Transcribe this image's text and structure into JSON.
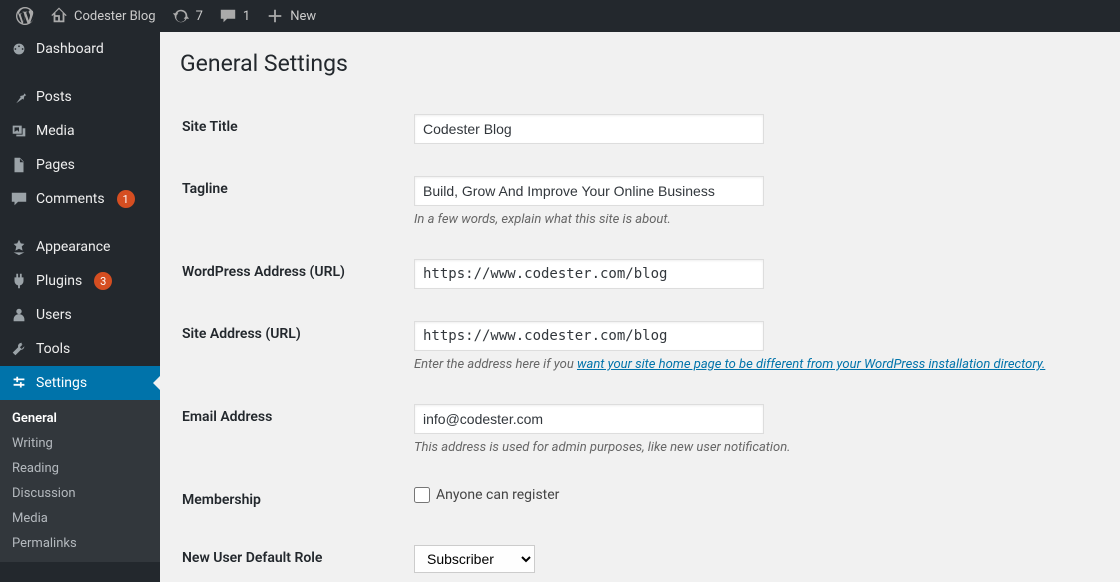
{
  "adminbar": {
    "site_name": "Codester Blog",
    "updates_count": "7",
    "comments_count": "1",
    "new_label": "New"
  },
  "sidebar": {
    "items": [
      {
        "label": "Dashboard",
        "icon": "dashboard"
      },
      {
        "label": "Posts",
        "icon": "pin"
      },
      {
        "label": "Media",
        "icon": "media"
      },
      {
        "label": "Pages",
        "icon": "pages"
      },
      {
        "label": "Comments",
        "icon": "comment",
        "badge": "1"
      },
      {
        "label": "Appearance",
        "icon": "appearance"
      },
      {
        "label": "Plugins",
        "icon": "plugin",
        "badge": "3"
      },
      {
        "label": "Users",
        "icon": "users"
      },
      {
        "label": "Tools",
        "icon": "tools"
      },
      {
        "label": "Settings",
        "icon": "settings",
        "active": true
      }
    ],
    "submenu": [
      {
        "label": "General",
        "current": true
      },
      {
        "label": "Writing"
      },
      {
        "label": "Reading"
      },
      {
        "label": "Discussion"
      },
      {
        "label": "Media"
      },
      {
        "label": "Permalinks"
      }
    ]
  },
  "page": {
    "title": "General Settings",
    "fields": {
      "site_title": {
        "label": "Site Title",
        "value": "Codester Blog"
      },
      "tagline": {
        "label": "Tagline",
        "value": "Build, Grow And Improve Your Online Business",
        "description": "In a few words, explain what this site is about."
      },
      "wp_url": {
        "label": "WordPress Address (URL)",
        "value": "https://www.codester.com/blog"
      },
      "site_url": {
        "label": "Site Address (URL)",
        "value": "https://www.codester.com/blog",
        "description_prefix": "Enter the address here if you ",
        "description_link": "want your site home page to be different from your WordPress installation directory."
      },
      "email": {
        "label": "Email Address",
        "value": "info@codester.com",
        "description": "This address is used for admin purposes, like new user notification."
      },
      "membership": {
        "label": "Membership",
        "checkbox_label": "Anyone can register"
      },
      "default_role": {
        "label": "New User Default Role",
        "value": "Subscriber"
      }
    }
  }
}
